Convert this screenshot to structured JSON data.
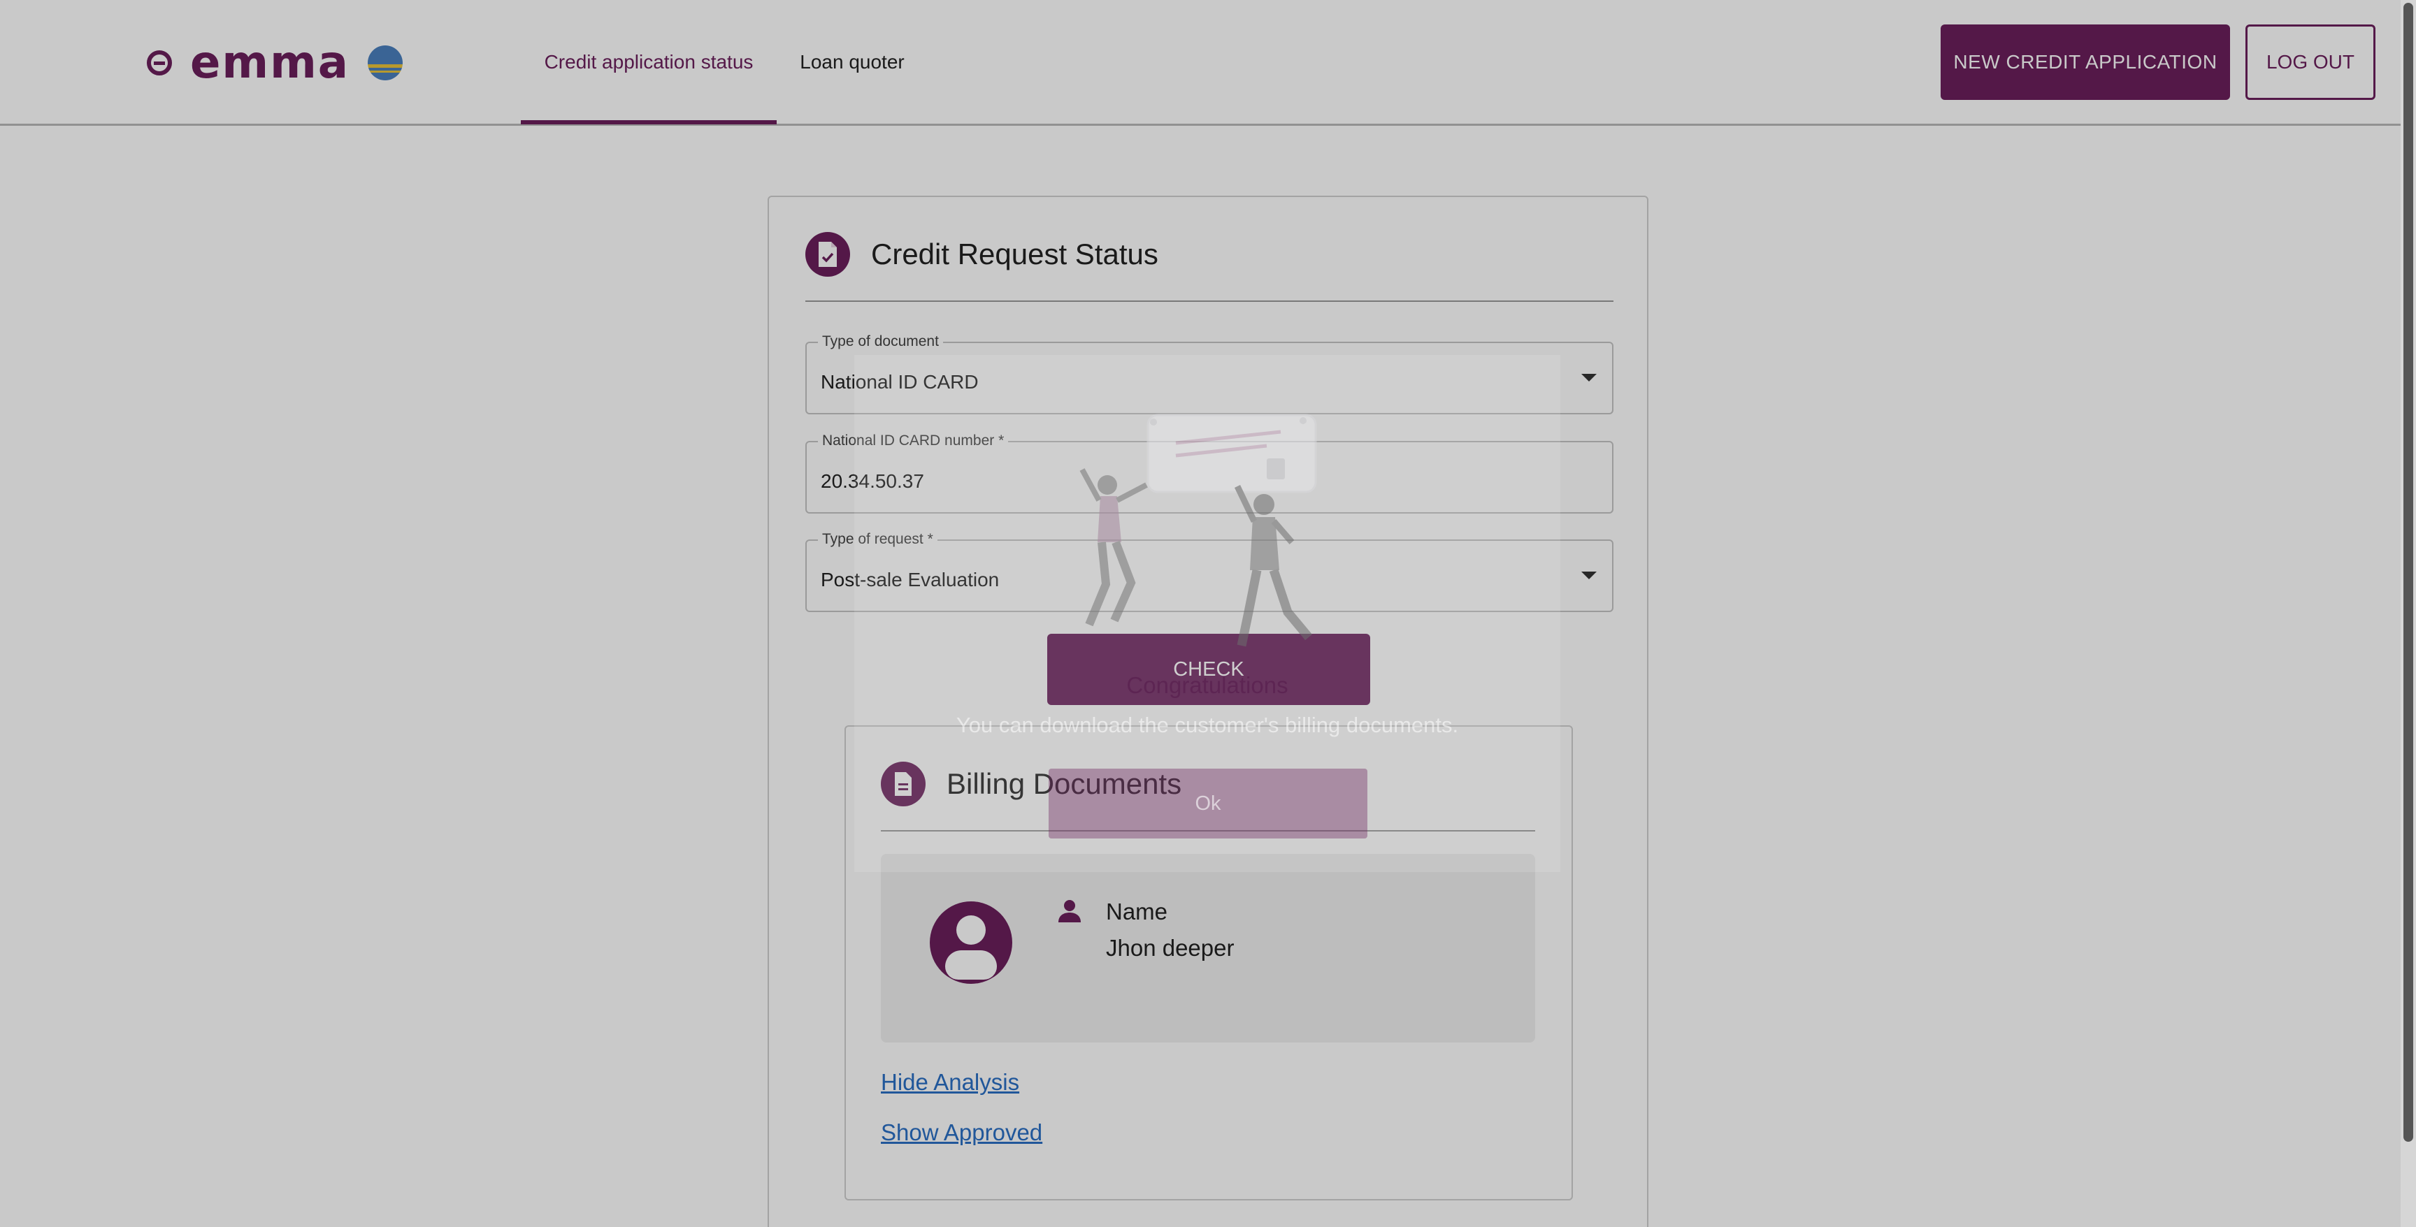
{
  "header": {
    "logo_text": "emma",
    "nav": [
      {
        "label": "Credit application status",
        "active": true
      },
      {
        "label": "Loan quoter",
        "active": false
      }
    ],
    "new_application_label": "NEW CREDIT APPLICATION",
    "logout_label": "LOG OUT"
  },
  "colors": {
    "brand": "#6b1f5c",
    "link": "#2a6fc4"
  },
  "form": {
    "title": "Credit Request Status",
    "icon": "document-check-icon",
    "document_type": {
      "label": "Type of document",
      "value": "National ID CARD"
    },
    "id_number": {
      "label": "National ID CARD number *",
      "value": "20.34.50.37"
    },
    "request_type": {
      "label": "Type of request *",
      "value": "Post-sale Evaluation"
    },
    "check_label": "CHECK"
  },
  "billing": {
    "title": "Billing Documents",
    "icon": "document-icon",
    "person": {
      "label": "Name",
      "value": "Jhon deeper",
      "icon": "person-icon"
    },
    "links": {
      "hide_analysis": "Hide Analysis",
      "show_approved": "Show Approved"
    }
  },
  "modal": {
    "title": "Congratulations",
    "message": "You can download the customer's billing documents.",
    "ok_label": "Ok",
    "illustration": "celebration-illustration"
  }
}
